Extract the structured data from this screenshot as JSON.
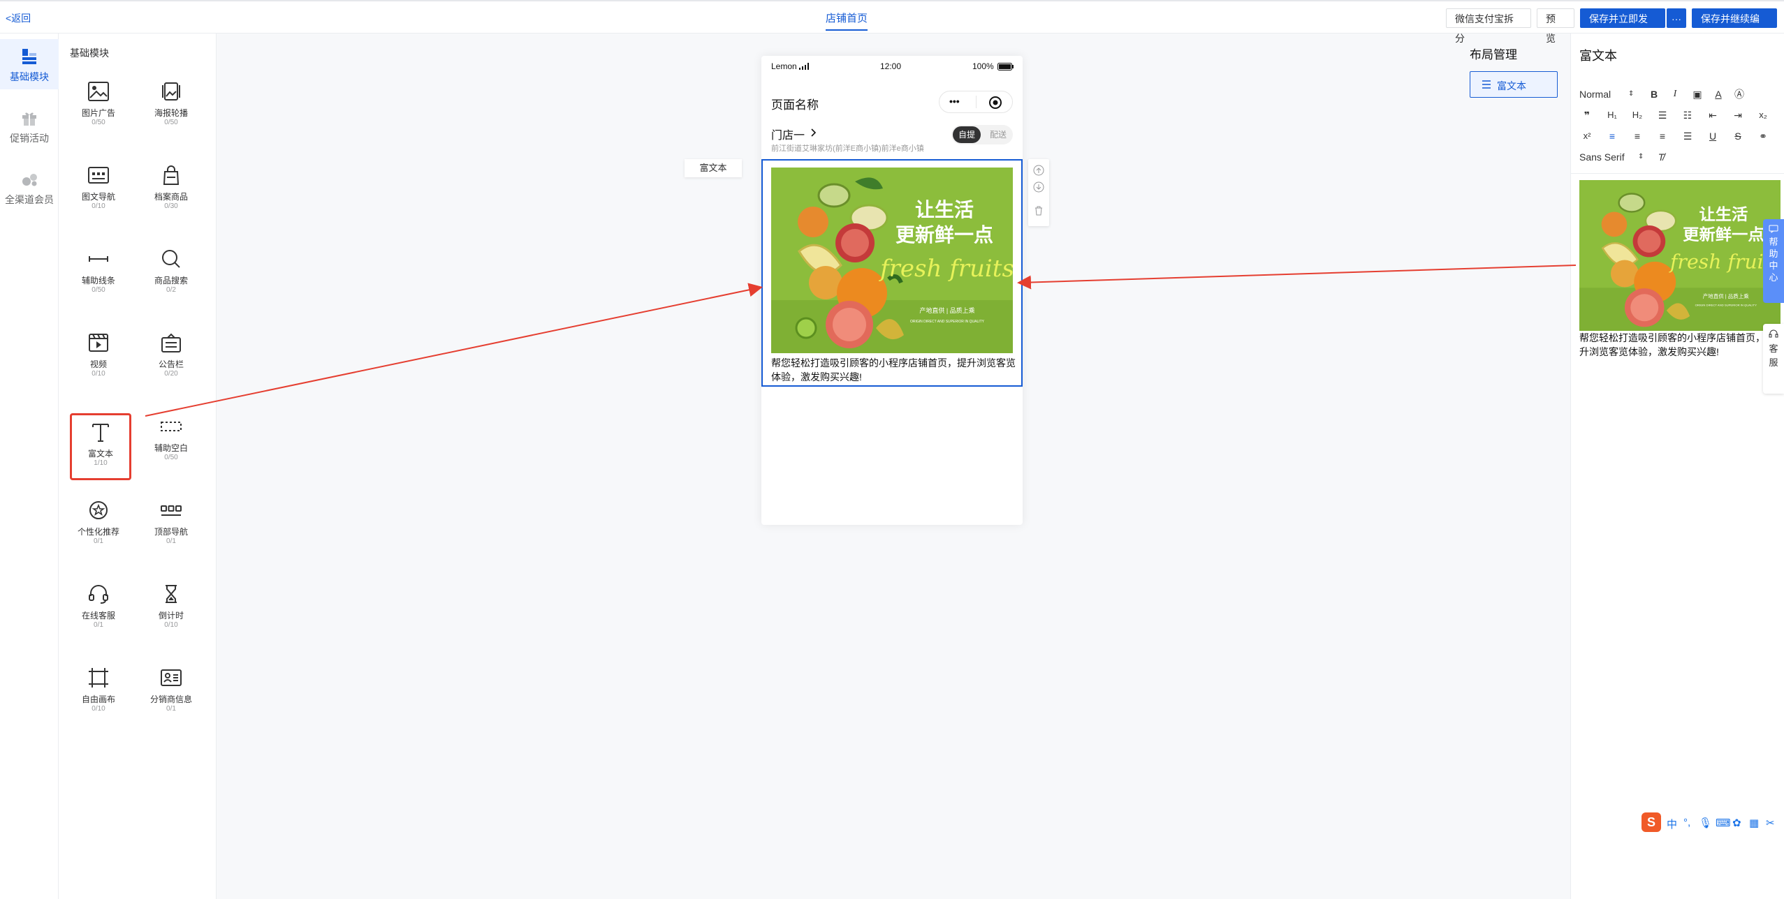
{
  "header": {
    "back_label": "<返回",
    "center_tab": "店铺首页",
    "buttons": {
      "split": "微信支付宝拆分",
      "preview": "预 览",
      "save_publish": "保存并立即发布",
      "more": "···",
      "save_continue": "保存并继续编辑"
    }
  },
  "left_nav": [
    {
      "label": "基础模块"
    },
    {
      "label": "促销活动"
    },
    {
      "label": "全渠道会员"
    }
  ],
  "module_panel": {
    "title": "基础模块",
    "modules": [
      {
        "name": "图片广告",
        "count": "0/50",
        "icon": "image-icon"
      },
      {
        "name": "海报轮播",
        "count": "0/50",
        "icon": "carousel-icon"
      },
      {
        "name": "图文导航",
        "count": "0/10",
        "icon": "image-text-nav-icon"
      },
      {
        "name": "档案商品",
        "count": "0/30",
        "icon": "bag-icon"
      },
      {
        "name": "辅助线条",
        "count": "0/50",
        "icon": "line-icon"
      },
      {
        "name": "商品搜索",
        "count": "0/2",
        "icon": "search-icon"
      },
      {
        "name": "视频",
        "count": "0/10",
        "icon": "video-icon"
      },
      {
        "name": "公告栏",
        "count": "0/20",
        "icon": "notice-icon"
      },
      {
        "name": "富文本",
        "count": "1/10",
        "icon": "text-icon"
      },
      {
        "name": "辅助空白",
        "count": "0/50",
        "icon": "blank-icon"
      },
      {
        "name": "个性化推荐",
        "count": "0/1",
        "icon": "star-badge-icon"
      },
      {
        "name": "顶部导航",
        "count": "0/1",
        "icon": "top-nav-icon"
      },
      {
        "name": "在线客服",
        "count": "0/1",
        "icon": "headset-icon"
      },
      {
        "name": "倒计时",
        "count": "0/10",
        "icon": "hourglass-icon"
      },
      {
        "name": "自由画布",
        "count": "0/10",
        "icon": "canvas-crop-icon"
      },
      {
        "name": "分销商信息",
        "count": "0/1",
        "icon": "id-card-icon"
      }
    ]
  },
  "canvas": {
    "floating_label": "富文本",
    "phone": {
      "carrier": "Lemon",
      "time": "12:00",
      "battery": "100%",
      "page_title": "页面名称",
      "store_name": "门店一",
      "store_address": "前江街道艾琳家坊(前洋E商小镇)前洋e商小镇",
      "pickup_label": "自提",
      "delivery_label": "配送",
      "banner": {
        "line1": "让生活",
        "line2": "更新鲜一点",
        "script": "fresh fruits",
        "tag": "产地直供 | 品质上乘",
        "tag_en": "ORIGIN DIRECT AND SUPERIOR IN QUALITY"
      },
      "rich_text": "帮您轻松打造吸引顾客的小程序店铺首页，提升浏览客览体验，激发购买兴趣!"
    }
  },
  "layout_manager": {
    "title": "布局管理",
    "item": "富文本"
  },
  "editor": {
    "title": "富文本",
    "format_select": "Normal",
    "font_select": "Sans Serif",
    "preview_text": "帮您轻松打造吸引顾客的小程序店铺首页，提升浏览客览体验，激发购买兴趣!"
  },
  "help_tab": {
    "top": "帮助中心",
    "bottom": "客服"
  },
  "ime": {
    "lang": "中"
  },
  "colors": {
    "accent": "#155bd4",
    "highlight": "#e53e30",
    "banner_bg": "#8cbd3c"
  }
}
